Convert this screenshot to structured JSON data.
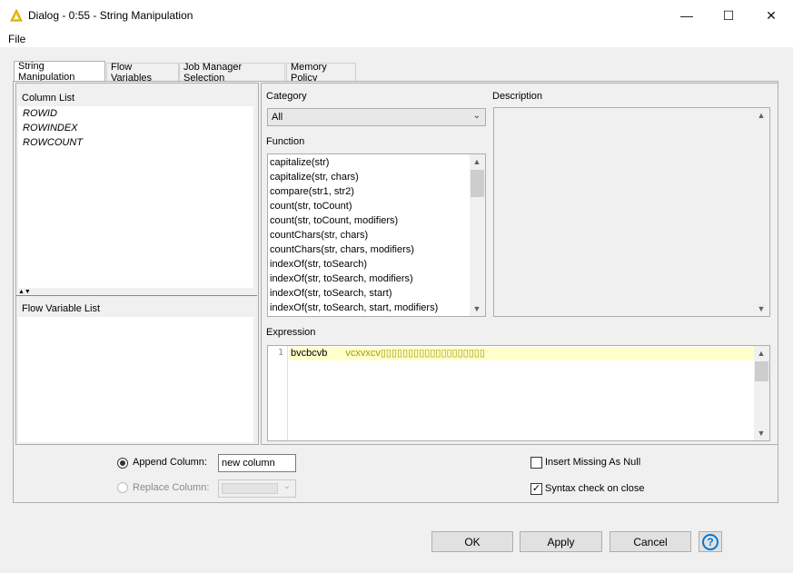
{
  "window": {
    "title": "Dialog - 0:55 - String Manipulation",
    "minimize_glyph": "—",
    "maximize_glyph": "☐",
    "close_glyph": "✕"
  },
  "menu": {
    "file_label": "File"
  },
  "tabs": [
    {
      "label": "String Manipulation"
    },
    {
      "label": "Flow Variables"
    },
    {
      "label": "Job Manager Selection"
    },
    {
      "label": "Memory Policy"
    }
  ],
  "column_list": {
    "label": "Column List",
    "items": [
      "ROWID",
      "ROWINDEX",
      "ROWCOUNT"
    ]
  },
  "flow_variable_list": {
    "label": "Flow Variable List"
  },
  "category": {
    "label": "Category",
    "selected": "All"
  },
  "description": {
    "label": "Description"
  },
  "function": {
    "label": "Function",
    "items": [
      "capitalize(str)",
      "capitalize(str, chars)",
      "compare(str1, str2)",
      "count(str, toCount)",
      "count(str, toCount, modifiers)",
      "countChars(str, chars)",
      "countChars(str, chars, modifiers)",
      "indexOf(str, toSearch)",
      "indexOf(str, toSearch, modifiers)",
      "indexOf(str, toSearch, start)",
      "indexOf(str, toSearch, start, modifiers)"
    ]
  },
  "expression": {
    "label": "Expression",
    "line_number": "1",
    "code_text": "bvcbcvb",
    "code_rest": "vcxvxcv▯▯▯▯▯▯▯▯▯▯▯▯▯▯▯▯▯▯▯",
    "highlight_color": "#ffffcc"
  },
  "options": {
    "append_label": "Append Column:",
    "append_value": "new column",
    "replace_label": "Replace Column:",
    "insert_missing_label": "Insert Missing As Null",
    "insert_missing_checked": false,
    "syntax_check_label": "Syntax check on close",
    "syntax_check_checked": true
  },
  "buttons": {
    "ok": "OK",
    "apply": "Apply",
    "cancel": "Cancel",
    "help_glyph": "?"
  },
  "colors": {
    "accent": "#0078d7",
    "title_icon": "#f5c518",
    "code_text": "#a0a000"
  }
}
